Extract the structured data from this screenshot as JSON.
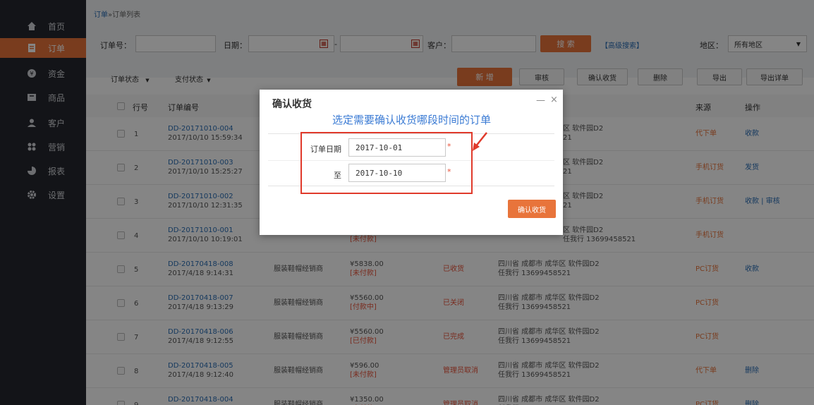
{
  "sidebar": {
    "items": [
      {
        "label": "首页",
        "icon": "home-icon"
      },
      {
        "label": "订单",
        "icon": "order-icon"
      },
      {
        "label": "资金",
        "icon": "money-icon"
      },
      {
        "label": "商品",
        "icon": "goods-icon"
      },
      {
        "label": "客户",
        "icon": "user-icon"
      },
      {
        "label": "营销",
        "icon": "marketing-icon"
      },
      {
        "label": "报表",
        "icon": "chart-icon"
      },
      {
        "label": "设置",
        "icon": "gear-icon"
      }
    ]
  },
  "breadcrumb": {
    "parent": "订单",
    "sep": "»",
    "current": "订单列表"
  },
  "search": {
    "order_no_label": "订单号：",
    "date_label": "日期：",
    "date_sep": "-",
    "customer_label": "客户：",
    "search_button": "搜 索",
    "advanced": "【高级搜索】",
    "region_label": "地区：",
    "region_value": "所有地区"
  },
  "toolbar": {
    "order_status": "订单状态",
    "pay_status": "支付状态",
    "add": "新 增",
    "audit": "审核",
    "confirm_receipt": "确认收货",
    "delete": "删除",
    "export": "导出",
    "export_detail": "导出详单"
  },
  "table": {
    "headers": {
      "row_no": "行号",
      "order_no": "订单编号",
      "source": "来源",
      "action": "操作"
    },
    "rows": [
      {
        "no": "1",
        "code": "DD-20171010-004",
        "time": "2017/10/10 15:59:34",
        "customer": "",
        "amount": "",
        "pay": "",
        "status": "",
        "addr": "区 软件园D2",
        "contact": "21",
        "source": "代下单",
        "actions": "收款"
      },
      {
        "no": "2",
        "code": "DD-20171010-003",
        "time": "2017/10/10 15:25:27",
        "customer": "",
        "amount": "",
        "pay": "",
        "status": "",
        "addr": "区 软件园D2",
        "contact": "21",
        "source": "手机订货",
        "actions": "发货"
      },
      {
        "no": "3",
        "code": "DD-20171010-002",
        "time": "2017/10/10 12:31:35",
        "customer": "",
        "amount": "",
        "pay": "",
        "status": "",
        "addr": "区 软件园D2",
        "contact": "21",
        "source": "手机订货",
        "actions": "收款 | 审核"
      },
      {
        "no": "4",
        "code": "DD-20171010-001",
        "time": "2017/10/10 10:19:01",
        "customer": "",
        "amount": "",
        "pay": "[未付款]",
        "status": "",
        "addr": "区 软件园D2",
        "contact": "任我行 13699458521",
        "source": "手机订货",
        "actions": ""
      },
      {
        "no": "5",
        "code": "DD-20170418-008",
        "time": "2017/4/18 9:14:31",
        "customer": "服装鞋帽经销商",
        "amount": "¥5838.00",
        "pay": "[未付款]",
        "status": "已收货",
        "addr": "四川省 成都市 成华区 软件园D2",
        "contact": "任我行 13699458521",
        "source": "PC订货",
        "actions": "收款"
      },
      {
        "no": "6",
        "code": "DD-20170418-007",
        "time": "2017/4/18 9:13:29",
        "customer": "服装鞋帽经销商",
        "amount": "¥5560.00",
        "pay": "[付款中]",
        "status": "已关闭",
        "addr": "四川省 成都市 成华区 软件园D2",
        "contact": "任我行 13699458521",
        "source": "PC订货",
        "actions": ""
      },
      {
        "no": "7",
        "code": "DD-20170418-006",
        "time": "2017/4/18 9:12:55",
        "customer": "服装鞋帽经销商",
        "amount": "¥5560.00",
        "pay": "[已付款]",
        "status": "已完成",
        "addr": "四川省 成都市 成华区 软件园D2",
        "contact": "任我行 13699458521",
        "source": "PC订货",
        "actions": ""
      },
      {
        "no": "8",
        "code": "DD-20170418-005",
        "time": "2017/4/18 9:12:40",
        "customer": "服装鞋帽经销商",
        "amount": "¥596.00",
        "pay": "[未付款]",
        "status": "管理员取消",
        "addr": "四川省 成都市 成华区 软件园D2",
        "contact": "任我行 13699458521",
        "source": "代下单",
        "actions": "删除"
      },
      {
        "no": "9",
        "code": "DD-20170418-004",
        "time": "2017/4/18 9:11:23",
        "customer": "服装鞋帽经销商",
        "amount": "¥1350.00",
        "pay": "[未付款]",
        "status": "管理员取消",
        "addr": "四川省 成都市 成华区 软件园D2",
        "contact": "任我行 13699458521",
        "source": "PC订货",
        "actions": "删除"
      }
    ]
  },
  "modal": {
    "title": "确认收货",
    "hint": "选定需要确认收货哪段时间的订单",
    "date_label": "订单日期",
    "to_label": "至",
    "start_date": "2017-10-01",
    "end_date": "2017-10-10",
    "required": "*",
    "confirm": "确认收货",
    "minimize": "—",
    "close": "×"
  },
  "colors": {
    "accent": "#e8743b",
    "link": "#2a6db5",
    "sidebar": "#26282e",
    "annotation": "#e03a2b"
  }
}
